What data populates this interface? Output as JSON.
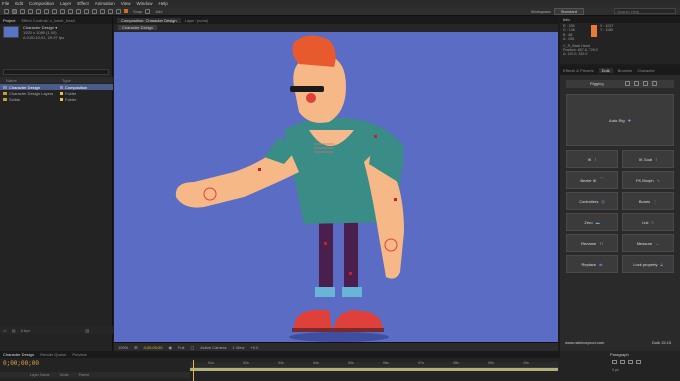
{
  "menu": [
    "File",
    "Edit",
    "Composition",
    "Layer",
    "Effect",
    "Animation",
    "View",
    "Window",
    "Help"
  ],
  "toolbar": {
    "snapping_label": "Snap",
    "add_label": "Add"
  },
  "workspace": {
    "label": "Workspace",
    "value": "Standard"
  },
  "search": {
    "placeholder": "Search Help"
  },
  "project": {
    "tabs": [
      "Project",
      "Effect Controls: c_lower_head"
    ],
    "comp_name": "Character Design ▾",
    "comp_size": "1920 x 1080 (1.00)",
    "comp_duration": "Δ 0;00;10;01, 29.97 fps",
    "columns": [
      "Name",
      "Type"
    ],
    "rows": [
      {
        "name": "Character Design",
        "type": "Composition",
        "icon": "comp",
        "swatch": "#9a8ac8"
      },
      {
        "name": "Character Design Layers",
        "type": "Folder",
        "icon": "folder",
        "swatch": "#e8c04a"
      },
      {
        "name": "Solids",
        "type": "Folder",
        "icon": "folder",
        "swatch": "#e8c04a"
      }
    ],
    "footer": "8 bpc"
  },
  "composition": {
    "tabs": [
      "Composition: Character Design",
      "Layer: (none)"
    ],
    "subtab": "Character Design",
    "viewer": {
      "zoom": "100%",
      "timecode": "0;00;00;00",
      "resolution": "Full",
      "camera": "Active Camera",
      "views": "1 View",
      "offset": "+0.0"
    },
    "bg_color": "#5a6cc4"
  },
  "info": {
    "tab": "Info",
    "rgb": [
      "R : 255",
      "G : 136",
      "B : 88",
      "A : 255"
    ],
    "xy": [
      "X : 1037",
      "Y : 1185"
    ],
    "layer_lines": [
      "C_R_Back Hand",
      "Position: 857.8, 728.0",
      "Δ: 120.0, 152.0"
    ]
  },
  "effects": {
    "tabs": [
      "Effects & Presets",
      "Duik",
      "Brushes",
      "Character"
    ]
  },
  "duik": {
    "section_title": "Rigging",
    "buttons": {
      "autorig": "Auto-Rig",
      "ik": "IK",
      "ik_goal": "IK Goal",
      "bezier_ik": "Bezier IK",
      "fk_morph": "FK Morph",
      "controllers": "Controllers",
      "bones": "Bones",
      "zero": "Zero",
      "list": "List",
      "rename": "Rename",
      "measure": "Measure",
      "replace": "Replace",
      "lock_property": "Lock property"
    },
    "url": "www.rainboxprod.com",
    "version": "Duik 15.15"
  },
  "timeline": {
    "tabs": [
      "Character Design",
      "Render Queue",
      "Preview"
    ],
    "time": "0;00;00;00",
    "ruler": [
      "01s",
      "02s",
      "03s",
      "04s",
      "05s",
      "06s",
      "07s",
      "08s",
      "09s",
      "10s"
    ],
    "layer_columns": [
      "Layer Name",
      "Mode",
      "Parent"
    ]
  },
  "paragraph": {
    "tab": "Paragraph",
    "indent": "0 px"
  }
}
